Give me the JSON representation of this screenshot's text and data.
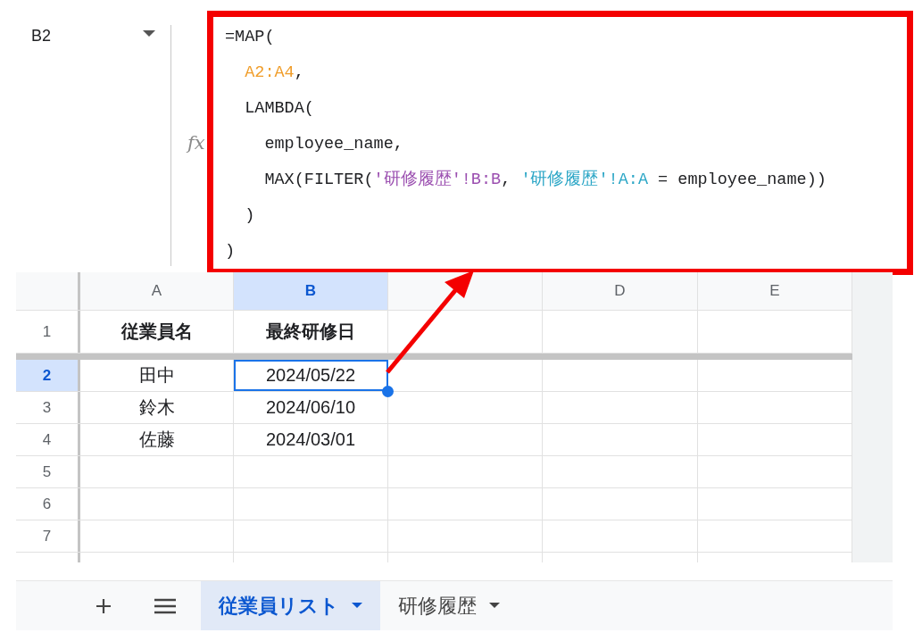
{
  "name_box": {
    "value": "B2"
  },
  "formula_bar": {
    "fx": "fx",
    "lines": [
      [
        {
          "text": "=MAP("
        }
      ],
      [
        {
          "text": "  A2:A4",
          "color": "#f09d2a"
        },
        {
          "text": ","
        }
      ],
      [
        {
          "text": "  LAMBDA("
        }
      ],
      [
        {
          "text": "    employee_name,"
        }
      ],
      [
        {
          "text": "    MAX(FILTER("
        },
        {
          "text": "'研修履歴'!B:B",
          "color": "#9b4fb0"
        },
        {
          "text": ", "
        },
        {
          "text": "'研修履歴'!A:A",
          "color": "#2ba6c6"
        },
        {
          "text": " = employee_name))"
        }
      ],
      [
        {
          "text": "  )"
        }
      ],
      [
        {
          "text": ")"
        }
      ]
    ]
  },
  "columns": [
    {
      "label": "A",
      "selected": false
    },
    {
      "label": "B",
      "selected": true
    },
    {
      "selected": false
    },
    {
      "label": "D",
      "selected": false
    },
    {
      "label": "E",
      "selected": false
    }
  ],
  "rows": [
    {
      "number": "1",
      "kind": "header",
      "selected": false,
      "cells": [
        {
          "text": "従業員名",
          "selected": false
        },
        {
          "text": "最終研修日",
          "selected": false
        }
      ]
    },
    {
      "number": "2",
      "kind": "data",
      "selected": true,
      "cells": [
        {
          "text": "田中",
          "selected": false
        },
        {
          "text": "2024/05/22",
          "selected": true
        }
      ]
    },
    {
      "number": "3",
      "kind": "data",
      "selected": false,
      "cells": [
        {
          "text": "鈴木",
          "selected": false
        },
        {
          "text": "2024/06/10",
          "selected": false
        }
      ]
    },
    {
      "number": "4",
      "kind": "data",
      "selected": false,
      "cells": [
        {
          "text": "佐藤",
          "selected": false
        },
        {
          "text": "2024/03/01",
          "selected": false
        }
      ]
    },
    {
      "number": "5",
      "kind": "data",
      "selected": false
    },
    {
      "number": "6",
      "kind": "data",
      "selected": false
    },
    {
      "number": "7",
      "kind": "data",
      "selected": false
    }
  ],
  "sheet_tabs": [
    {
      "label": "従業員リスト",
      "selected": true
    },
    {
      "label": "研修履歴",
      "selected": false
    }
  ]
}
